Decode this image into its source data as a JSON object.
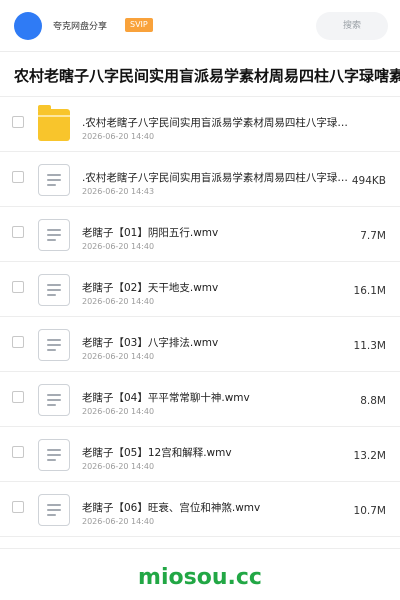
{
  "header": {
    "username": "夸克网盘分享",
    "vip_badge": "SVIP",
    "search_placeholder": "搜索"
  },
  "title": "农村老瞎子八字民间实用盲派易学素材周易四柱八字琭嗐素",
  "files": [
    {
      "name": ".农村老瞎子八字民间实用盲派易学素材周易四柱八字琭…",
      "date": "2026-06-20 14:40",
      "size": "",
      "type": "folder"
    },
    {
      "name": ".农村老瞎子八字民间实用盲派易学素材周易四柱八字琭…",
      "date": "2026-06-20 14:43",
      "size": "494KB",
      "type": "file"
    },
    {
      "name": "老瞎子【01】阴阳五行.wmv",
      "date": "2026-06-20 14:40",
      "size": "7.7M",
      "type": "file"
    },
    {
      "name": "老瞎子【02】天干地支.wmv",
      "date": "2026-06-20 14:40",
      "size": "16.1M",
      "type": "file"
    },
    {
      "name": "老瞎子【03】八字排法.wmv",
      "date": "2026-06-20 14:40",
      "size": "11.3M",
      "type": "file"
    },
    {
      "name": "老瞎子【04】平平常常聊十神.wmv",
      "date": "2026-06-20 14:40",
      "size": "8.8M",
      "type": "file"
    },
    {
      "name": "老瞎子【05】12宫和解释.wmv",
      "date": "2026-06-20 14:40",
      "size": "13.2M",
      "type": "file"
    },
    {
      "name": "老瞎子【06】旺衰、宫位和神煞.wmv",
      "date": "2026-06-20 14:40",
      "size": "10.7M",
      "type": "file"
    }
  ],
  "footer": {
    "watermark": "miosou.cc"
  },
  "colors": {
    "accent": "#2f7bf5",
    "vip": "#f9a23b",
    "folder": "#f8c52c",
    "watermark": "#22a745"
  }
}
